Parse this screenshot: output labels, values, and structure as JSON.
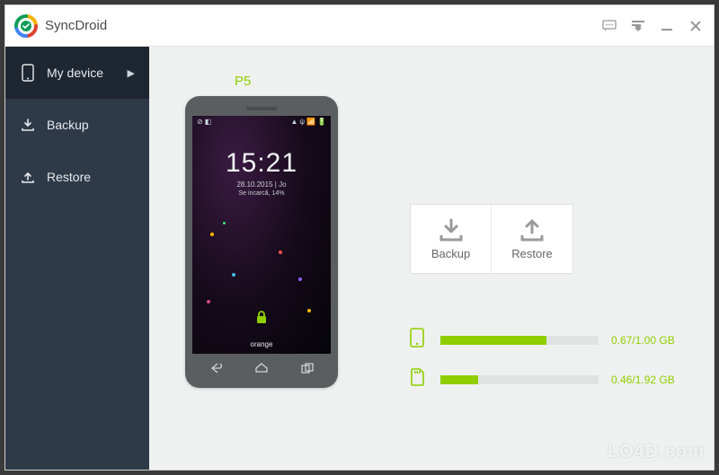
{
  "app": {
    "title": "SyncDroid"
  },
  "window_controls": {
    "feedback": "feedback-icon",
    "menu": "menu-icon",
    "minimize": "minimize-icon",
    "close": "close-icon"
  },
  "sidebar": {
    "items": [
      {
        "id": "my-device",
        "label": "My device",
        "active": true,
        "has_submenu": true
      },
      {
        "id": "backup",
        "label": "Backup",
        "active": false
      },
      {
        "id": "restore",
        "label": "Restore",
        "active": false
      }
    ]
  },
  "device": {
    "name": "P5",
    "clock": "15:21",
    "date": "28.10.2015",
    "weekday": "Jo",
    "charging_text": "Se incarcă, 14%",
    "carrier": "orange"
  },
  "actions": {
    "backup_label": "Backup",
    "restore_label": "Restore"
  },
  "storage": {
    "internal": {
      "used": 0.67,
      "total": 1.0,
      "unit": "GB",
      "text": "0.67/1.00 GB",
      "pct": 67
    },
    "sdcard": {
      "used": 0.46,
      "total": 1.92,
      "unit": "GB",
      "text": "0.46/1.92 GB",
      "pct": 24
    }
  },
  "colors": {
    "accent": "#8fce00",
    "sidebar_bg": "#2f3a48",
    "sidebar_active": "#1e2631"
  },
  "watermark": "LO4D.com"
}
